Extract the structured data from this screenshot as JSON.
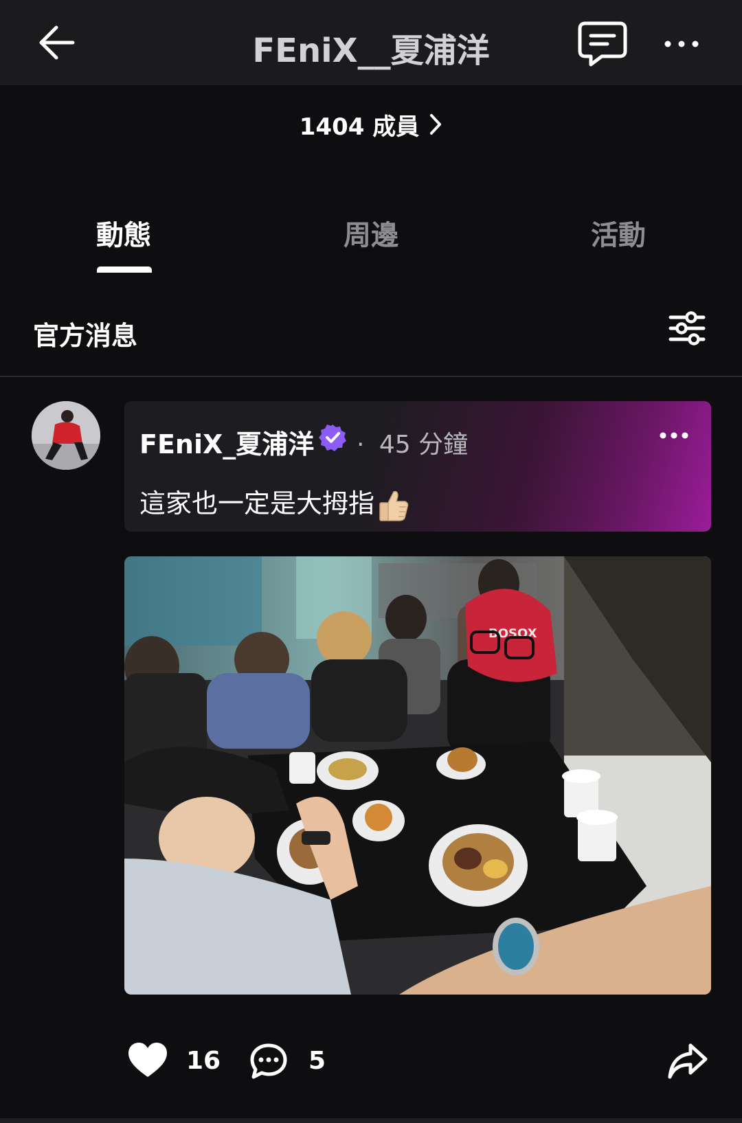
{
  "header": {
    "title": "FEniX__夏浦洋",
    "members_label": "1404 成員"
  },
  "tabs": [
    {
      "label": "動態",
      "active": true
    },
    {
      "label": "周邊",
      "active": false
    },
    {
      "label": "活動",
      "active": false
    }
  ],
  "section": {
    "title": "官方消息"
  },
  "post": {
    "author": "FEniX_夏浦洋",
    "separator": "·",
    "time": "45 分鐘",
    "text": "這家也一定是大拇指",
    "text_emoji": "thumbs-up",
    "image_alt": "A group eating at a table in a restaurant",
    "likes": "16",
    "comments": "5"
  },
  "colors": {
    "accent_verified": "#8b5cf6",
    "gradient_end": "#9b1c9a",
    "background": "#0e0e10"
  },
  "icons": [
    "back-arrow-icon",
    "chat-icon",
    "more-icon",
    "chevron-right-icon",
    "filter-icon",
    "verified-icon",
    "heart-icon",
    "comment-icon",
    "share-icon"
  ]
}
